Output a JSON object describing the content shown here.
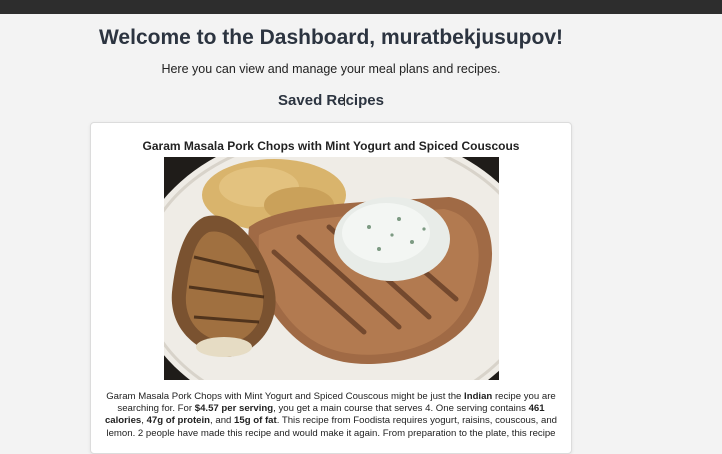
{
  "header": {
    "welcome": "Welcome to the Dashboard, muratbekjusupov!",
    "subtitle": "Here you can view and manage your meal plans and recipes."
  },
  "saved_recipes": {
    "heading": "Saved Recipes",
    "recipes": [
      {
        "title": "Garam Masala Pork Chops with Mint Yogurt and Spiced Couscous",
        "image_icon": "recipe-photo",
        "summary": {
          "part1": "Garam Masala Pork Chops with Mint Yogurt and Spiced Couscous might be just the ",
          "cuisine": "Indian",
          "part2": " recipe you are searching for. For ",
          "price": "$4.57 per serving",
          "part3": ", you get a main course that serves 4. One serving contains ",
          "calories": "461 calories",
          "part4": ", ",
          "protein": "47g of protein",
          "part5": ", and ",
          "fat": "15g of fat",
          "part6": ". This recipe from Foodista requires yogurt, raisins, couscous, and lemon. 2 people have made this recipe and would make it again. From preparation to the plate, this recipe"
        }
      }
    ]
  },
  "colors": {
    "topbar": "#2d2d2d",
    "background": "#f3f3f3",
    "heading": "#2c3440"
  }
}
